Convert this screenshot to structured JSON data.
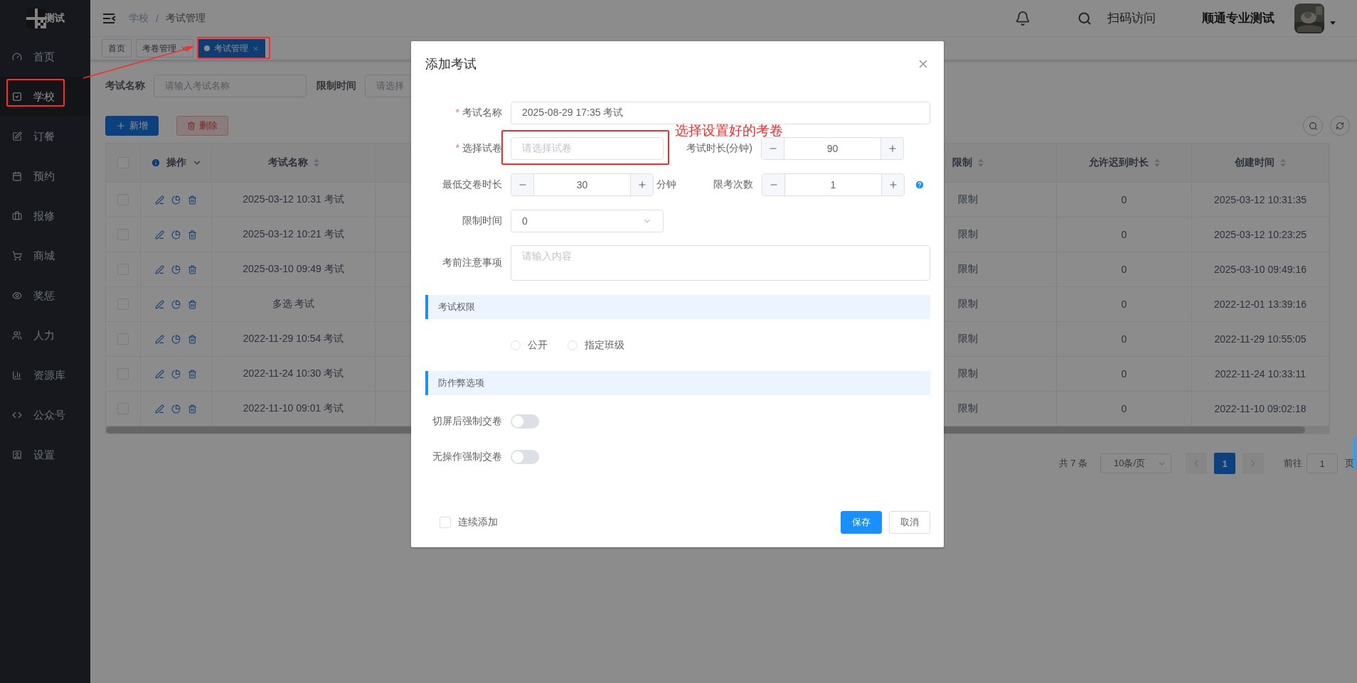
{
  "sidebar": {
    "logo_text": "测试",
    "items": [
      {
        "label": "首页",
        "selected": false
      },
      {
        "label": "学校",
        "selected": true
      },
      {
        "label": "订餐",
        "selected": false
      },
      {
        "label": "预约",
        "selected": false
      },
      {
        "label": "报修",
        "selected": false
      },
      {
        "label": "商城",
        "selected": false
      },
      {
        "label": "奖惩",
        "selected": false
      },
      {
        "label": "人力",
        "selected": false
      },
      {
        "label": "资源库",
        "selected": false
      },
      {
        "label": "公众号",
        "selected": false
      },
      {
        "label": "设置",
        "selected": false
      }
    ]
  },
  "header": {
    "breadcrumb": [
      "学校",
      "考试管理"
    ],
    "breadcrumb_separator": "/",
    "link": "扫码访问",
    "user_name": "顺通专业测试"
  },
  "tabs": [
    {
      "label": "首页",
      "closable": false,
      "selected": false
    },
    {
      "label": "考卷管理",
      "closable": true,
      "selected": false
    },
    {
      "label": "考试管理",
      "closable": true,
      "selected": true
    }
  ],
  "filters": [
    {
      "label": "考试名称",
      "kind": "input",
      "placeholder": "请输入考试名称"
    },
    {
      "label": "限制时间",
      "kind": "select",
      "placeholder": "请选择"
    }
  ],
  "toolbar": {
    "buttons": [
      {
        "label": "新增",
        "kind": "primary",
        "disabled": false
      },
      {
        "label": "删除",
        "kind": "danger",
        "disabled": true
      }
    ]
  },
  "table": {
    "all_checked": false,
    "columns": [
      {
        "label": "操作",
        "kind": "actions"
      },
      {
        "label": "考试名称",
        "kind": "sortable"
      },
      {
        "label": "限制",
        "kind": "sortable"
      },
      {
        "label": "允许迟到时长",
        "kind": "sortable"
      },
      {
        "label": "创建时间",
        "kind": "sortable"
      }
    ],
    "rows": [
      {
        "checked": false,
        "cells": [
          "",
          "2025-03-12 10:31 考试",
          "限制",
          "0",
          "2025-03-12 10:31:35"
        ]
      },
      {
        "checked": false,
        "cells": [
          "",
          "2025-03-12 10:21 考试",
          "限制",
          "0",
          "2025-03-12 10:23:25"
        ]
      },
      {
        "checked": false,
        "cells": [
          "",
          "2025-03-10 09:49 考试",
          "限制",
          "0",
          "2025-03-10 09:49:16"
        ]
      },
      {
        "checked": false,
        "cells": [
          "",
          "多选 考试",
          "限制",
          "0",
          "2022-12-01 13:39:16"
        ]
      },
      {
        "checked": false,
        "cells": [
          "",
          "2022-11-29 10:54 考试",
          "限制",
          "0",
          "2022-11-29 10:55:05"
        ]
      },
      {
        "checked": false,
        "cells": [
          "",
          "2022-11-24 10:30 考试",
          "限制",
          "0",
          "2022-11-24 10:33:11"
        ]
      },
      {
        "checked": false,
        "cells": [
          "",
          "2022-11-10 09:01 考试",
          "限制",
          "0",
          "2022-11-10 09:02:18"
        ]
      }
    ]
  },
  "pagination": {
    "total": "共 7 条",
    "page_size": "10条/页",
    "pages": [
      {
        "label": "1",
        "selected": true
      }
    ],
    "goto_label": "前往",
    "goto_value": "1",
    "goto_suffix": "页"
  },
  "dialog": {
    "title": "添加考试",
    "required_mark": "*",
    "rows": [
      [
        {
          "kind": "input",
          "label": "考试名称",
          "required": true,
          "value": "2025-08-29 17:35 考试"
        }
      ],
      [
        {
          "kind": "input",
          "label": "选择试卷",
          "required": true,
          "placeholder": "请选择试卷"
        },
        {
          "kind": "stepper",
          "label": "考试时长(分钟)",
          "required": false,
          "value": "90",
          "help": false
        }
      ],
      [
        {
          "kind": "stepper",
          "label": "最低交卷时长",
          "required": false,
          "value": "30",
          "unit": "分钟",
          "help": false
        },
        {
          "kind": "stepper",
          "label": "限考次数",
          "required": false,
          "value": "1",
          "help": true
        }
      ],
      [
        {
          "kind": "select",
          "label": "限制时间",
          "required": false,
          "value": "0"
        }
      ],
      [
        {
          "kind": "textarea",
          "label": "考前注意事项",
          "required": false,
          "placeholder": "请输入内容"
        }
      ]
    ],
    "sections": [
      {
        "title": "考试权限",
        "kind": "radios",
        "options": [
          {
            "label": "公开",
            "selected": false
          },
          {
            "label": "指定班级",
            "selected": false
          }
        ]
      },
      {
        "title": "防作弊选项",
        "kind": "switches",
        "options": [
          {
            "label": "切屏后强制交卷",
            "on": false
          },
          {
            "label": "无操作强制交卷",
            "on": false
          }
        ]
      }
    ],
    "footer": {
      "checkbox": {
        "label": "连续添加",
        "checked": false
      },
      "buttons": [
        {
          "label": "保存",
          "kind": "primary"
        },
        {
          "label": "取消",
          "kind": "default"
        }
      ]
    }
  },
  "annotation": {
    "callout": "选择设置好的考卷"
  }
}
